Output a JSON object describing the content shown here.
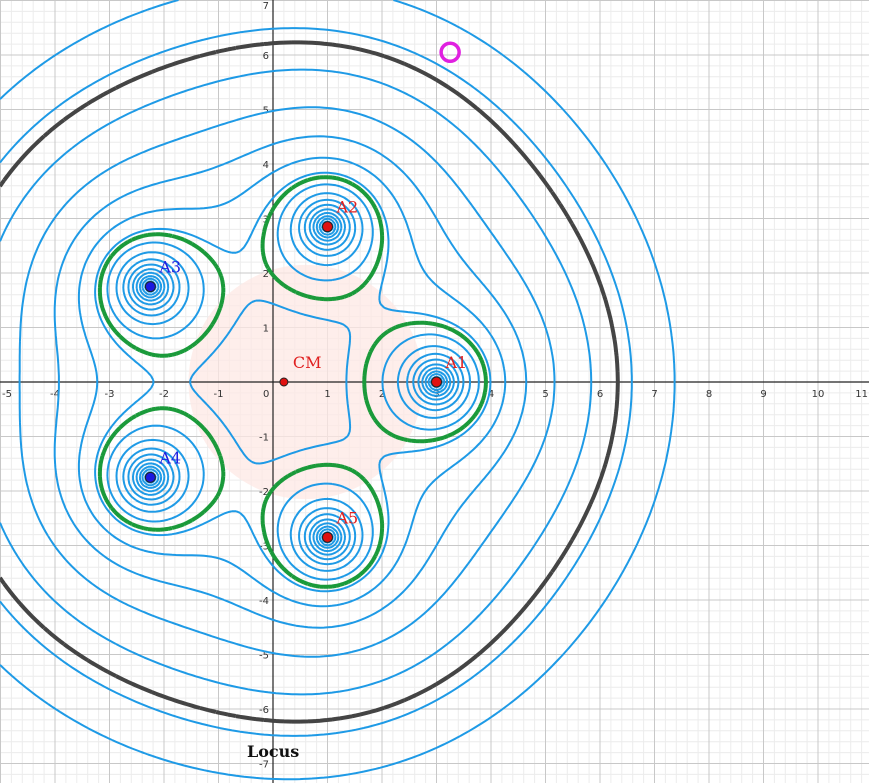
{
  "view": {
    "x_range": [
      -5,
      11
    ],
    "y_range": [
      -7,
      7
    ],
    "x_tick_labels": [
      "-5",
      "-4",
      "-3",
      "-2",
      "-1",
      "0",
      "1",
      "2",
      "3",
      "4",
      "5",
      "6",
      "7",
      "8",
      "9",
      "10",
      "11"
    ],
    "y_tick_labels": [
      "7",
      "6",
      "5",
      "4",
      "3",
      "2",
      "1",
      "-1",
      "-2",
      "-3",
      "-4",
      "-5",
      "-6",
      "-7"
    ]
  },
  "colors": {
    "contour": "#1e9ae6",
    "green_level": "#1a9a3a",
    "dark_level": "#444444",
    "red_point": "#e01010",
    "blue_point": "#1a1ae0",
    "red_label": "#e02020",
    "blue_label": "#2020e0",
    "marker": "#e020e0",
    "shade": "#fde8e4"
  },
  "points": [
    {
      "label": "A1",
      "x": 3.0,
      "y": 0.0,
      "color": "red"
    },
    {
      "label": "A2",
      "x": 1.0,
      "y": 2.85,
      "color": "red"
    },
    {
      "label": "A3",
      "x": -2.25,
      "y": 1.75,
      "color": "blue"
    },
    {
      "label": "A4",
      "x": -2.25,
      "y": -1.75,
      "color": "blue"
    },
    {
      "label": "A5",
      "x": 1.0,
      "y": -2.85,
      "color": "red"
    },
    {
      "label": "CM",
      "x": 0.2,
      "y": 0.0,
      "color": "red"
    }
  ],
  "marker": {
    "x": 3.25,
    "y": 6.05
  },
  "caption": "Locus"
}
